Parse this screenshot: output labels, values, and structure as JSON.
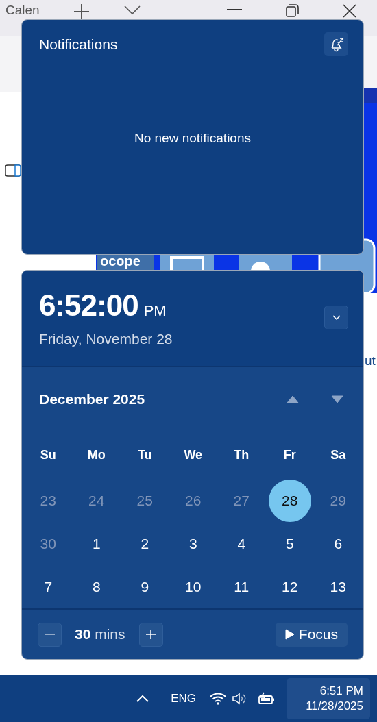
{
  "background": {
    "tab_title": "Calen",
    "texts": [
      "ocope",
      "ut"
    ]
  },
  "notifications": {
    "title": "Notifications",
    "empty_message": "No new notifications"
  },
  "clock": {
    "time": "6:52:00",
    "meridiem": "PM",
    "date": "Friday, November 28"
  },
  "calendar": {
    "month": "December 2025",
    "weekdays": [
      "Su",
      "Mo",
      "Tu",
      "We",
      "Th",
      "Fr",
      "Sa"
    ],
    "days": [
      {
        "label": "23",
        "muted": true,
        "selected": false
      },
      {
        "label": "24",
        "muted": true,
        "selected": false
      },
      {
        "label": "25",
        "muted": true,
        "selected": false
      },
      {
        "label": "26",
        "muted": true,
        "selected": false
      },
      {
        "label": "27",
        "muted": true,
        "selected": false
      },
      {
        "label": "28",
        "muted": false,
        "selected": true
      },
      {
        "label": "29",
        "muted": true,
        "selected": false
      },
      {
        "label": "30",
        "muted": true,
        "selected": false
      },
      {
        "label": "1",
        "muted": false,
        "selected": false
      },
      {
        "label": "2",
        "muted": false,
        "selected": false
      },
      {
        "label": "3",
        "muted": false,
        "selected": false
      },
      {
        "label": "4",
        "muted": false,
        "selected": false
      },
      {
        "label": "5",
        "muted": false,
        "selected": false
      },
      {
        "label": "6",
        "muted": false,
        "selected": false
      },
      {
        "label": "7",
        "muted": false,
        "selected": false
      },
      {
        "label": "8",
        "muted": false,
        "selected": false
      },
      {
        "label": "9",
        "muted": false,
        "selected": false
      },
      {
        "label": "10",
        "muted": false,
        "selected": false
      },
      {
        "label": "11",
        "muted": false,
        "selected": false
      },
      {
        "label": "12",
        "muted": false,
        "selected": false
      },
      {
        "label": "13",
        "muted": false,
        "selected": false
      }
    ]
  },
  "focus": {
    "duration": "**30** mins",
    "button": "Focus"
  },
  "taskbar": {
    "language": "ENG",
    "time": "6:51 PM",
    "date": "11/28/2025"
  }
}
